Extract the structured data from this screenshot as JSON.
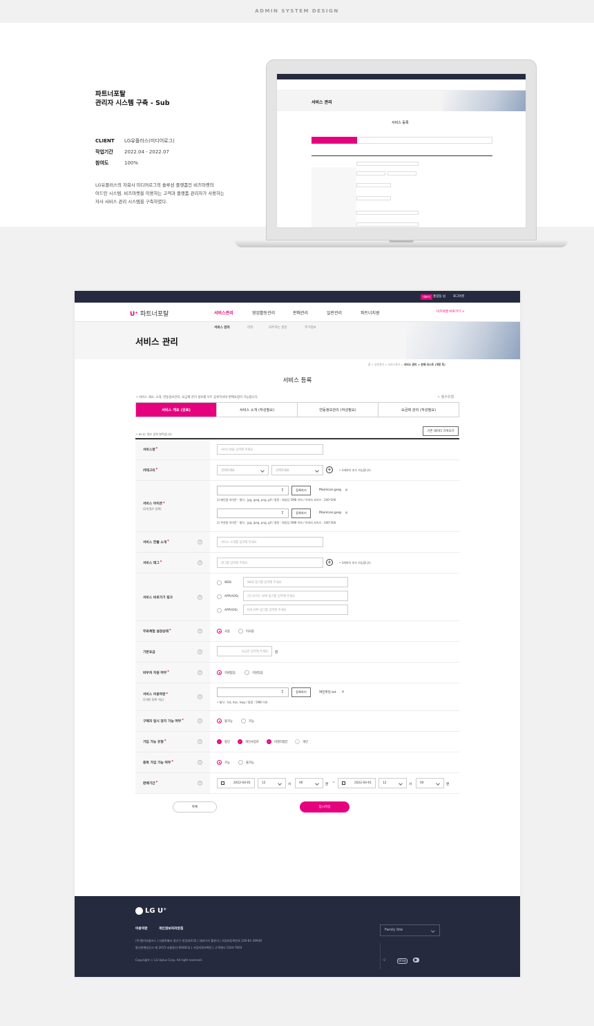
{
  "heading": "ADMIN SYSTEM DESIGN",
  "project": {
    "title_line1": "파트너포탈",
    "title_line2": "관리자 시스템 구축 - Sub",
    "client_label": "CLIENT",
    "client": "LG유플러스(미디어로그)",
    "period_label": "작업기간",
    "period": "2022.04 - 2022.07",
    "participation_label": "참여도",
    "participation": "100%",
    "desc_line1": "LG유플러스의 자회사 미디어로그의 솔루션 플랫폼인 비즈마켓의",
    "desc_line2": "어드민 시스템. 비즈마켓을 이용하는 고객과 플랫폼 관리자가 사용하는",
    "desc_line3": "자사 서비스 관리 시스템을 구축하였다."
  },
  "mini": {
    "banner_title": "서비스 관리",
    "page_title": "서비스 등록"
  },
  "top": {
    "manager_badge": "대표자",
    "user": "홍길동 님",
    "logout": "로그아웃"
  },
  "logo": {
    "mark": "U⁺",
    "name": "파트너포탈"
  },
  "gnb": [
    "서비스관리",
    "영업활동관리",
    "판매관리",
    "일반관리",
    "파트너지원"
  ],
  "bizmarket_link": "비즈마켓 바로가기 >",
  "subnav": [
    "서비스 관리",
    "리뷰",
    "자주하는 질문",
    "추가정보"
  ],
  "banner_title": "서비스 관리",
  "breadcrumb": {
    "path": "홈 > 일반관리 > 서비스관리 >",
    "current": "서비스 관리 > 판매 리스트 (개정 후)"
  },
  "page_title": "서비스 등록",
  "notice": "• 서비스 개요, 소개, 연동정보관리, 요금제 관리 정보를 모두 등록하셔야 판매요청이 가능합니다.",
  "required_label": "필수유형",
  "tabs": [
    "서비스 개요 (완료)",
    "서비스 소개 (작성필요)",
    "연동정보관리 (작성필요)",
    "요금제 관리 (작성필요)"
  ],
  "required_note": "• 표시는 필수 입력 항목입니다.",
  "load_button": "기존 데이터 가져오기",
  "form": {
    "service_name": {
      "label": "서비스명",
      "placeholder": "서비스명을 입력해 주세요"
    },
    "category": {
      "label": "카테고리",
      "select1": "선택하세요",
      "select2": "선택하세요",
      "hint": "• 3개까지 추가 가능합니다."
    },
    "icon": {
      "label": "서비스 아이콘",
      "sub": "(2개 필수 등록)",
      "register": "등록하기",
      "file1": "MainIcon.jpeg",
      "file2": "MainIcon.jpeg",
      "hint1": "1) 메인용 아이콘 - 형식 : jpg, jpeg, png, gif  /  용량 : 파일당 5MB 이하  /  이미지 사이즈 : 200*200",
      "hint2": "2) 주천용 아이콘 - 형식 : jpg, jpeg, png, gif  /  용량 : 파일당 5MB 이하  /  이미지 사이즈 : 300*300"
    },
    "intro": {
      "label": "서비스 한줄 소개",
      "placeholder": "서비스 소개를 입력해 주세요"
    },
    "tag": {
      "label": "서비스 태그",
      "placeholder": "태그를 입력해 주세요",
      "hint": "• 3개까지 추가 가능합니다."
    },
    "link": {
      "label": "서비스 바로가기 링크",
      "web": "WEB",
      "aos": "APP(AOS)",
      "ios": "APP(IOS)",
      "web_ph": "WEB 링크를 입력해 주세요",
      "aos_ph": "안드로이드 APP 링크를 입력해 주세요",
      "ios_ph": "IOS APP 링크를 입력해 주세요"
    },
    "trial": {
      "label": "무료체험 설정상태",
      "opt1": "사용",
      "opt2": "미사용"
    },
    "fee": {
      "label": "기본요금",
      "placeholder": "요금만 입력해 주세요",
      "unit": "원"
    },
    "voucher": {
      "label": "바우처 지원 여부",
      "opt1": "지원없음",
      "opt2": "지원있음"
    },
    "terms": {
      "label": "서비스 이용약관",
      "sub": "(1개만 등록 가능)",
      "register": "등록하기",
      "file": "여민파일.txt",
      "hint": "• 형식 : txt, doc, hwp  /  용량 : 5MB 이하"
    },
    "pause": {
      "label": "구매자 일시 정지 가능 여부",
      "opt1": "불가능",
      "opt2": "가능"
    },
    "join_type": {
      "label": "가입 가능 유형",
      "opt1": "법인",
      "opt2": "개인사업자",
      "opt3": "비영리법인",
      "opt4": "개인"
    },
    "dup": {
      "label": "중복 가입 가능 여부",
      "opt1": "가능",
      "opt2": "불가능"
    },
    "period": {
      "label": "판매기간",
      "date1": "2022-04-01",
      "h1": "12",
      "m1": "00",
      "date2": "2022-04-01",
      "h2": "12",
      "m2": "00",
      "hour_unit": "시",
      "min_unit": "분",
      "tilde": "~"
    }
  },
  "buttons": {
    "list": "목록",
    "save": "임시저장"
  },
  "footer": {
    "logo": "LG U⁺",
    "link1": "이용약관",
    "link2": "개인정보처리방침",
    "addr1": "(주)엘지유플러스  |  서울특별시 용산구 한강대로32  |  대표이사 황현식  |  사업자등록번호 220-81-39938",
    "addr2": "통신판매업신고 제 2015-서울용산-00481호  |  사업자정보확인  |  고객센터 1544-7003",
    "copyright": "Copyright ⓒ LG Uplus Corp. All right reserved.",
    "family": "Family Site"
  }
}
